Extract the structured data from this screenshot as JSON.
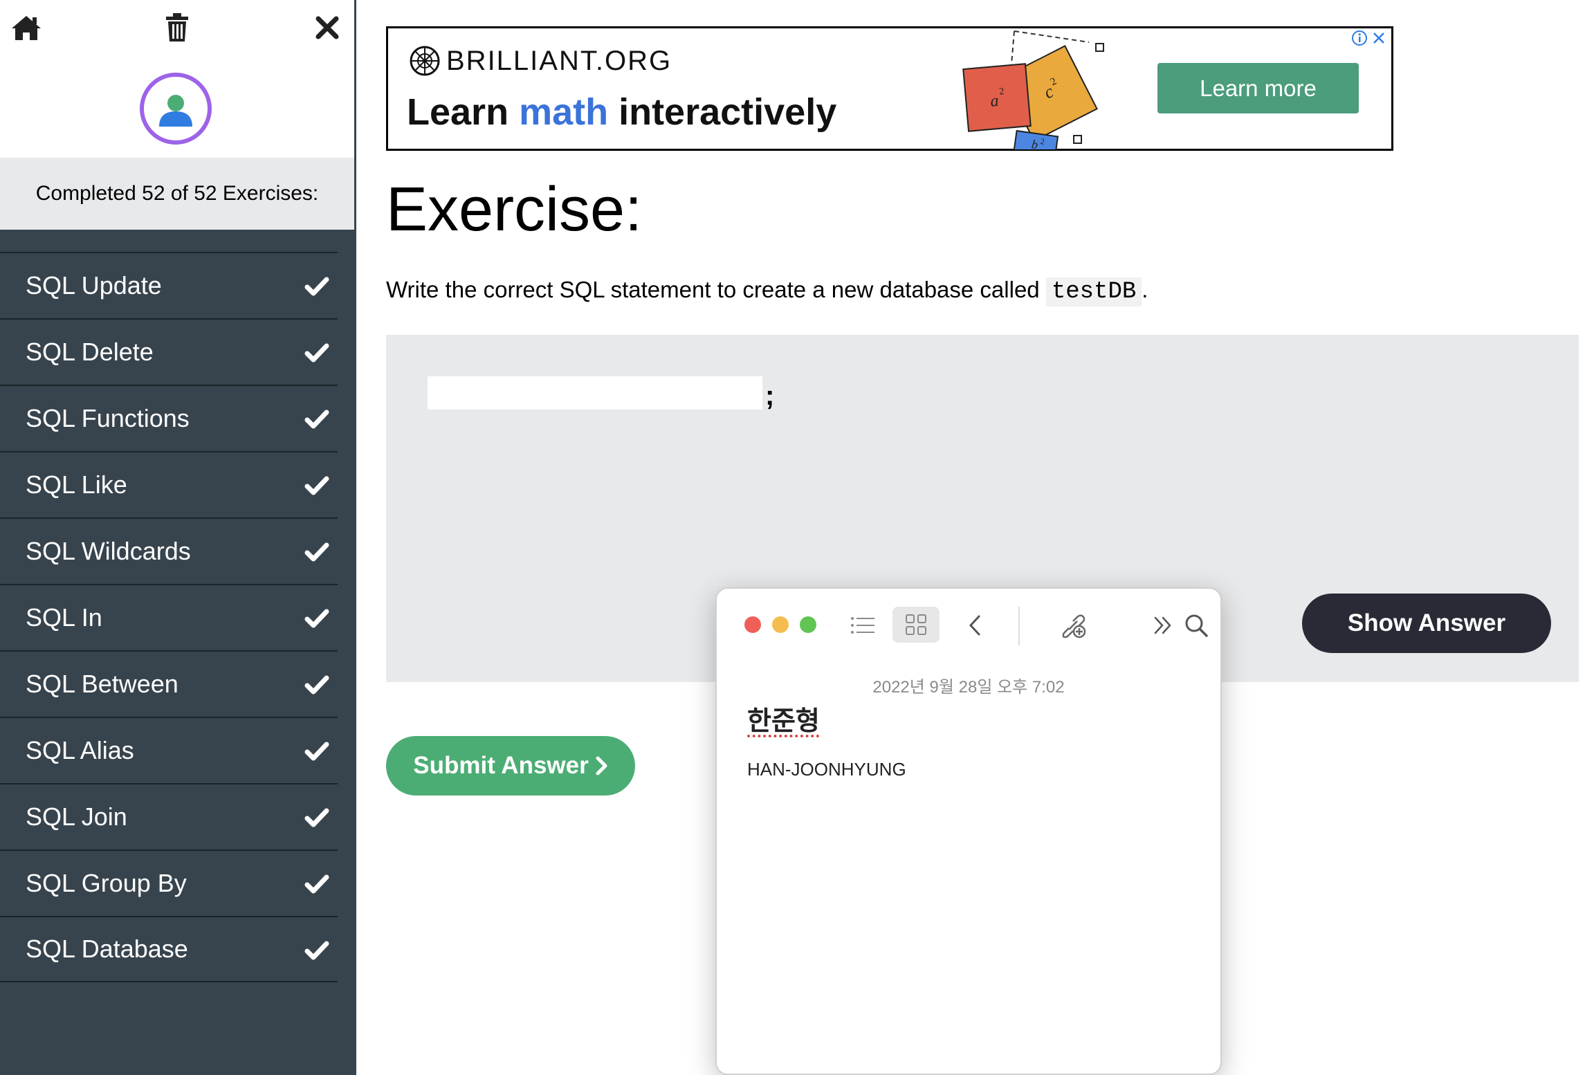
{
  "sidebar": {
    "icons": {
      "home": "home-icon",
      "trash": "trash-icon",
      "close": "close-icon",
      "avatar": "user-icon"
    },
    "progress_text": "Completed 52 of 52 Exercises:",
    "items": [
      {
        "label": "SQL Update",
        "done": true
      },
      {
        "label": "SQL Delete",
        "done": true
      },
      {
        "label": "SQL Functions",
        "done": true
      },
      {
        "label": "SQL Like",
        "done": true
      },
      {
        "label": "SQL Wildcards",
        "done": true
      },
      {
        "label": "SQL In",
        "done": true
      },
      {
        "label": "SQL Between",
        "done": true
      },
      {
        "label": "SQL Alias",
        "done": true
      },
      {
        "label": "SQL Join",
        "done": true
      },
      {
        "label": "SQL Group By",
        "done": true
      },
      {
        "label": "SQL Database",
        "done": true
      }
    ]
  },
  "ad": {
    "brand": "BRILLIANT.ORG",
    "headline_pre": "Learn ",
    "headline_accent": "math",
    "headline_post": " interactively",
    "cta": "Learn more",
    "art_labels": {
      "a": "a",
      "b": "b",
      "c": "c",
      "exp": "2"
    },
    "colors": {
      "button": "#4b9d7c",
      "accent": "#3a73d9",
      "square_a": "#e15f4a",
      "square_c": "#e9a93d",
      "square_b": "#4c86e0"
    }
  },
  "exercise": {
    "title": "Exercise:",
    "instruction_pre": "Write the correct SQL statement to create a new database called ",
    "instruction_code": "testDB",
    "instruction_post": ".",
    "input_value": "",
    "semicolon": ";",
    "show_answer": "Show Answer",
    "submit_answer": "Submit Answer",
    "submit_icon": "chevron-right-icon"
  },
  "notes_window": {
    "date": "2022년 9월 28일 오후 7:02",
    "title": "한준형",
    "body": "HAN-JOONHYUNG",
    "traffic_lights": {
      "close": "#ed5f57",
      "minimize": "#f5bd4f",
      "zoom": "#61c554"
    }
  }
}
